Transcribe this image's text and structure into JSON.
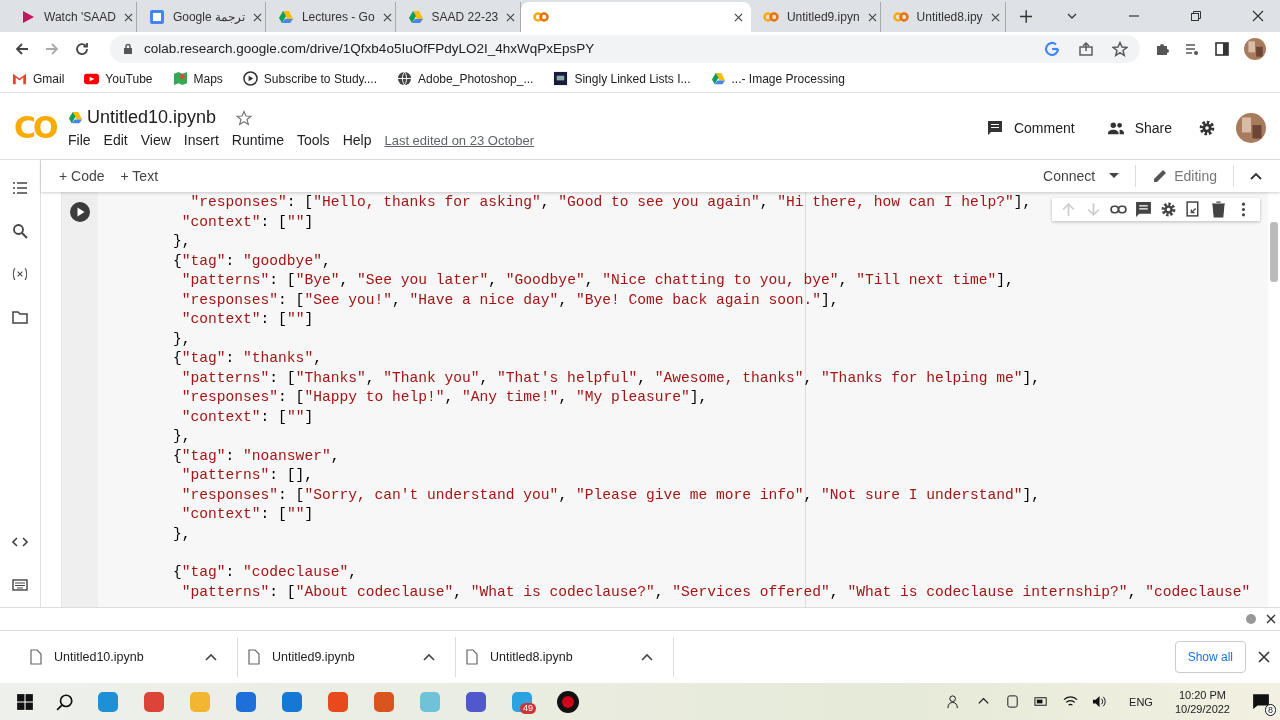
{
  "browser": {
    "tabs": [
      {
        "title": "Watch 'SAAD",
        "kind": "play",
        "selected": false
      },
      {
        "title": "Google ترجمة",
        "kind": "translate",
        "selected": false
      },
      {
        "title": "Lectures - Go",
        "kind": "drive",
        "selected": false
      },
      {
        "title": "SAAD 22-23",
        "kind": "drive",
        "selected": false
      },
      {
        "kind": "colab",
        "selected": true
      },
      {
        "title": "Untitled9.ipyn",
        "kind": "colab",
        "selected": false
      },
      {
        "title": "Untitled8.ipy",
        "kind": "colab",
        "selected": false
      }
    ],
    "url": "colab.research.google.com/drive/1Qfxb4o5IuOfFPdyLO2I_4hxWqPxEpsPY",
    "bookmarks": [
      {
        "label": "Gmail",
        "kind": "gmail"
      },
      {
        "label": "YouTube",
        "kind": "youtube"
      },
      {
        "label": "Maps",
        "kind": "maps"
      },
      {
        "label": "Subscribe to Study....",
        "kind": "play"
      },
      {
        "label": "Adobe_Photoshop_...",
        "kind": "globe"
      },
      {
        "label": "Singly Linked Lists I...",
        "kind": "sf"
      },
      {
        "label": "...- Image Processing",
        "kind": "drive"
      }
    ]
  },
  "notebook": {
    "logo": "CO",
    "title": "Untitled10.ipynb",
    "menu": [
      "File",
      "Edit",
      "View",
      "Insert",
      "Runtime",
      "Tools",
      "Help"
    ],
    "last_edited": "Last edited on 23 October",
    "comment": "Comment",
    "share": "Share"
  },
  "toolbar": {
    "add_code": "+ Code",
    "add_text": "+ Text",
    "connect": "Connect",
    "editing": "Editing"
  },
  "code_lines": [
    {
      "text": "  \"responses\": [\"Hello, thanks for asking\", \"Good to see you again\", \"Hi there, how can I help?\"],"
    },
    {
      "text": " \"context\": [\"\"]"
    },
    {
      "text": "},"
    },
    {
      "text": "{\"tag\": \"goodbye\","
    },
    {
      "text": " \"patterns\": [\"Bye\", \"See you later\", \"Goodbye\", \"Nice chatting to you, bye\", \"Till next time\"],"
    },
    {
      "text": " \"responses\": [\"See you!\", \"Have a nice day\", \"Bye! Come back again soon.\"],"
    },
    {
      "text": " \"context\": [\"\"]"
    },
    {
      "text": "},"
    },
    {
      "text": "{\"tag\": \"thanks\","
    },
    {
      "text": " \"patterns\": [\"Thanks\", \"Thank you\", \"That's helpful\", \"Awesome, thanks\", \"Thanks for helping me\"],"
    },
    {
      "text": " \"responses\": [\"Happy to help!\", \"Any time!\", \"My pleasure\"],"
    },
    {
      "text": " \"context\": [\"\"]"
    },
    {
      "text": "},"
    },
    {
      "text": "{\"tag\": \"noanswer\","
    },
    {
      "text": " \"patterns\": [],"
    },
    {
      "text": " \"responses\": [\"Sorry, can't understand you\", \"Please give me more info\", \"Not sure I understand\"],"
    },
    {
      "text": " \"context\": [\"\"]"
    },
    {
      "text": "},"
    },
    {
      "text": "{\"tag\": \"codeclause\",",
      "blank_before": true
    },
    {
      "text": " \"patterns\": [\"About codeclause\", \"What is codeclause?\", \"Services offered\", \"What is codeclause internship?\", \"codeclause\""
    }
  ],
  "downloads": {
    "files": [
      "Untitled10.ipynb",
      "Untitled9.ipynb",
      "Untitled8.ipynb"
    ],
    "show_all": "Show all"
  },
  "taskbar": {
    "apps": [
      {
        "kind": "edge"
      },
      {
        "kind": "chrome"
      },
      {
        "kind": "files"
      },
      {
        "kind": "store"
      },
      {
        "kind": "mail"
      },
      {
        "kind": "office"
      },
      {
        "kind": "matlab"
      },
      {
        "kind": "notes"
      },
      {
        "kind": "teams"
      },
      {
        "kind": "telegram",
        "badge": "49"
      },
      {
        "kind": "record"
      }
    ],
    "lang": "ENG",
    "time": "10:20 PM",
    "date": "10/29/2022",
    "notif_count": "8"
  }
}
